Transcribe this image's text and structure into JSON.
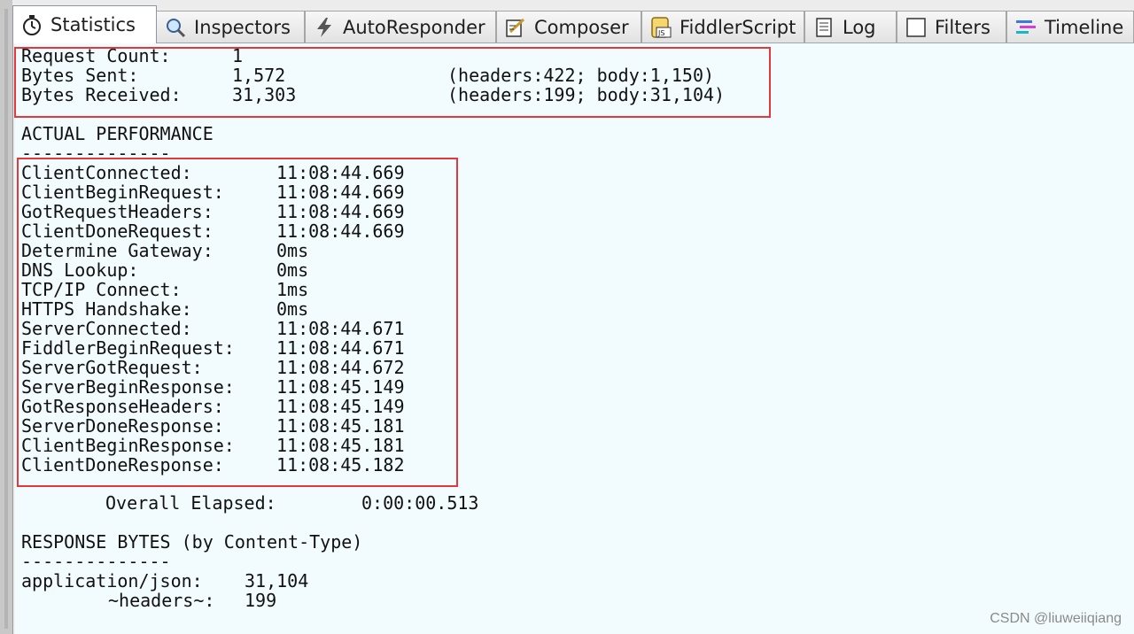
{
  "tabs": [
    {
      "label": "Statistics",
      "icon": "stopwatch-icon"
    },
    {
      "label": "Inspectors",
      "icon": "magnifier-icon"
    },
    {
      "label": "AutoResponder",
      "icon": "lightning-icon"
    },
    {
      "label": "Composer",
      "icon": "edit-icon"
    },
    {
      "label": "FiddlerScript",
      "icon": "script-js-icon"
    },
    {
      "label": "Log",
      "icon": "document-icon"
    },
    {
      "label": "Filters",
      "icon": "checkbox-icon"
    },
    {
      "label": "Timeline",
      "icon": "timeline-icon"
    }
  ],
  "summary": {
    "request_count_label": "Request Count:",
    "request_count": "1",
    "bytes_sent_label": "Bytes Sent:",
    "bytes_sent": "1,572",
    "bytes_sent_detail": "(headers:422; body:1,150)",
    "bytes_received_label": "Bytes Received:",
    "bytes_received": "31,303",
    "bytes_received_detail": "(headers:199; body:31,104)"
  },
  "performance": {
    "heading": "ACTUAL PERFORMANCE",
    "separator": "--------------",
    "rows": [
      {
        "label": "ClientConnected:",
        "value": "11:08:44.669"
      },
      {
        "label": "ClientBeginRequest:",
        "value": "11:08:44.669"
      },
      {
        "label": "GotRequestHeaders:",
        "value": "11:08:44.669"
      },
      {
        "label": "ClientDoneRequest:",
        "value": "11:08:44.669"
      },
      {
        "label": "Determine Gateway:",
        "value": "0ms"
      },
      {
        "label": "DNS Lookup:",
        "value": "0ms"
      },
      {
        "label": "TCP/IP Connect:",
        "value": "1ms"
      },
      {
        "label": "HTTPS Handshake:",
        "value": "0ms"
      },
      {
        "label": "ServerConnected:",
        "value": "11:08:44.671"
      },
      {
        "label": "FiddlerBeginRequest:",
        "value": "11:08:44.671"
      },
      {
        "label": "ServerGotRequest:",
        "value": "11:08:44.672"
      },
      {
        "label": "ServerBeginResponse:",
        "value": "11:08:45.149"
      },
      {
        "label": "GotResponseHeaders:",
        "value": "11:08:45.149"
      },
      {
        "label": "ServerDoneResponse:",
        "value": "11:08:45.181"
      },
      {
        "label": "ClientBeginResponse:",
        "value": "11:08:45.181"
      },
      {
        "label": "ClientDoneResponse:",
        "value": "11:08:45.182"
      }
    ],
    "overall_label": "Overall Elapsed:",
    "overall_value": "0:00:00.513"
  },
  "response_bytes": {
    "heading": "RESPONSE BYTES (by Content-Type)",
    "separator": "--------------",
    "rows": [
      {
        "label": "application/json:",
        "value": "31,104"
      },
      {
        "label": "~headers~:",
        "value": "199"
      }
    ]
  },
  "watermark": "CSDN @liuweiiqiang",
  "colors": {
    "highlight_box": "#e4393c",
    "content_background": "#f2fcff"
  }
}
